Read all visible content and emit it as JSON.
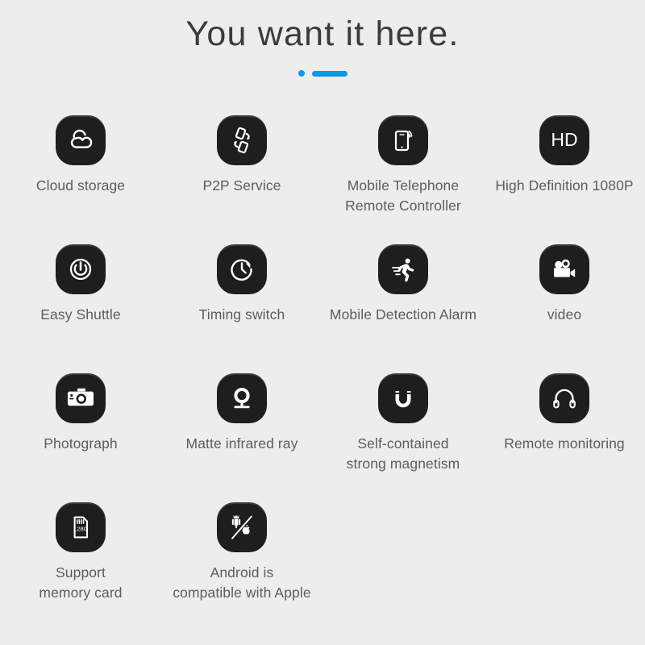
{
  "header": {
    "title": "You want it here.",
    "accent_color": "#0d9ae4",
    "accent_dot": "bullet-dot",
    "accent_bar": "bullet-bar"
  },
  "theme": {
    "background": "#ededed",
    "icon_background": "#1e1e1e",
    "icon_foreground": "#ffffff",
    "label_color": "#5d5d5d",
    "title_color": "#3b3b3b"
  },
  "features": [
    {
      "icon": "cloud-icon",
      "label_line1": "Cloud storage",
      "label_line2": ""
    },
    {
      "icon": "p2p-phones-icon",
      "label_line1": "P2P Service",
      "label_line2": ""
    },
    {
      "icon": "phone-wifi-icon",
      "label_line1": "Mobile Telephone",
      "label_line2": "Remote Controller"
    },
    {
      "icon": "hd-badge-icon",
      "label_line1": "High Definition 1080P",
      "label_line2": ""
    },
    {
      "icon": "power-button-icon",
      "label_line1": "Easy Shuttle",
      "label_line2": ""
    },
    {
      "icon": "clock-arrow-icon",
      "label_line1": "Timing switch",
      "label_line2": ""
    },
    {
      "icon": "running-person-icon",
      "label_line1": "Mobile Detection Alarm",
      "label_line2": ""
    },
    {
      "icon": "movie-camera-icon",
      "label_line1": "video",
      "label_line2": ""
    },
    {
      "icon": "photo-camera-icon",
      "label_line1": "Photograph",
      "label_line2": ""
    },
    {
      "icon": "webcam-icon",
      "label_line1": "Matte infrared ray",
      "label_line2": ""
    },
    {
      "icon": "magnet-icon",
      "label_line1": "Self-contained",
      "label_line2": "strong magnetism"
    },
    {
      "icon": "headphones-icon",
      "label_line1": "Remote monitoring",
      "label_line2": ""
    },
    {
      "icon": "memory-card-icon",
      "label_line1": "Support",
      "label_line2": "memory card"
    },
    {
      "icon": "android-apple-icon",
      "label_line1": "Android is",
      "label_line2": "compatible  with Apple"
    }
  ],
  "icon_text": {
    "hd": "HD",
    "memory_capacity": "128G"
  }
}
